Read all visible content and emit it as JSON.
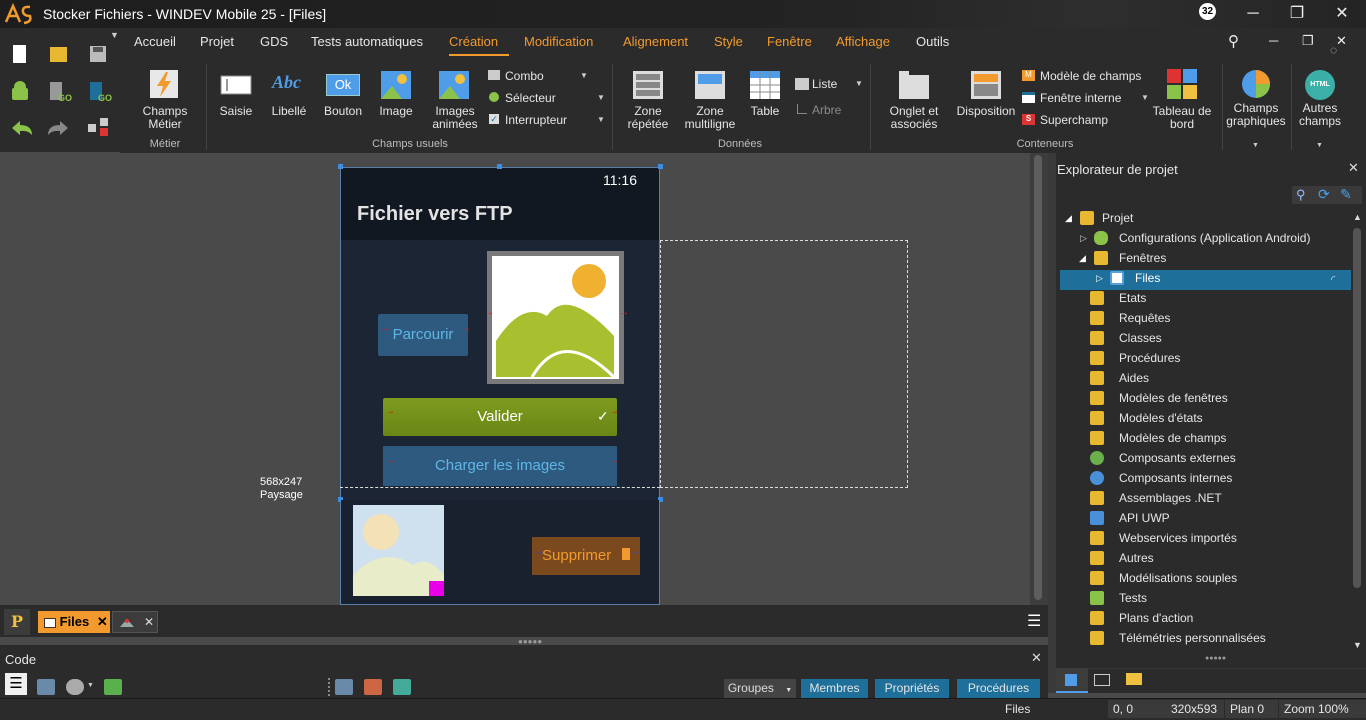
{
  "window": {
    "title": "Stocker Fichiers - WINDEV Mobile 25 - [Files]",
    "notification_count": "32",
    "controls": {
      "minimize": "─",
      "restore": "❐",
      "close": "✕"
    },
    "app_controls": {
      "search": "⚲",
      "minimize": "─",
      "restore": "❐",
      "close": "✕"
    }
  },
  "menu": {
    "items": [
      "Accueil",
      "Projet",
      "GDS",
      "Tests automatiques",
      "Création",
      "Modification",
      "Alignement",
      "Style",
      "Fenêtre",
      "Affichage",
      "Outils"
    ],
    "active": "Création",
    "orange_items": [
      "Création",
      "Modification",
      "Alignement",
      "Style",
      "Fenêtre",
      "Affichage"
    ]
  },
  "ribbon": {
    "groups": {
      "metier": "Métier",
      "champs_usuels": "Champs usuels",
      "donnees": "Données",
      "conteneurs": "Conteneurs"
    },
    "champs_metier": "Champs\nMétier",
    "saisie": "Saisie",
    "libelle": "Libellé",
    "bouton": "Bouton",
    "image": "Image",
    "images_animees": "Images\nanimées",
    "combo": "Combo",
    "selecteur": "Sélecteur",
    "interrupteur": "Interrupteur",
    "zone_repetee": "Zone\nrépétée",
    "zone_multiligne": "Zone\nmultiligne",
    "table": "Table",
    "liste": "Liste",
    "arbre": "Arbre",
    "onglet": "Onglet et\nassociés",
    "disposition": "Disposition",
    "modele_champs": "Modèle de champs",
    "fenetre_interne": "Fenêtre interne",
    "superchamp": "Superchamp",
    "tableau_bord": "Tableau de\nbord",
    "champs_graphiques": "Champs\ngraphiques",
    "autres_champs": "Autres\nchamps",
    "abc_icon": "Abc",
    "ok_icon": "Ok",
    "html_icon": "HTML"
  },
  "phone": {
    "time": "11:16",
    "title": "Fichier vers FTP",
    "btn_parcourir": "Parcourir",
    "btn_valider": "Valider",
    "btn_charger": "Charger les images",
    "btn_supprimer": "Supprimer",
    "size_label": "568x247",
    "orientation_label": "Paysage"
  },
  "doc_tabs": {
    "project_button": "P",
    "files_tab": "Files",
    "close": "✕"
  },
  "code_panel": {
    "title": "Code",
    "close": "✕",
    "groupes": "Groupes",
    "membres": "Membres",
    "proprietes": "Propriétés",
    "procedures": "Procédures"
  },
  "explorer": {
    "title": "Explorateur de projet",
    "close": "✕",
    "items": [
      {
        "label": "Projet",
        "color": "#e8b830"
      },
      {
        "label": "Configurations (Application Android)",
        "color": "#8bc34a"
      },
      {
        "label": "Fenêtres",
        "color": "#e8b830"
      },
      {
        "label": "Files",
        "color": "#5aa0d8"
      },
      {
        "label": "Etats",
        "color": "#e8b830"
      },
      {
        "label": "Requêtes",
        "color": "#e8b830"
      },
      {
        "label": "Classes",
        "color": "#e8b830"
      },
      {
        "label": "Procédures",
        "color": "#e8b830"
      },
      {
        "label": "Aides",
        "color": "#e8b830"
      },
      {
        "label": "Modèles de fenêtres",
        "color": "#e8b830"
      },
      {
        "label": "Modèles d'états",
        "color": "#e8b830"
      },
      {
        "label": "Modèles de champs",
        "color": "#e8b830"
      },
      {
        "label": "Composants externes",
        "color": "#6ab04c"
      },
      {
        "label": "Composants internes",
        "color": "#4a90d9"
      },
      {
        "label": "Assemblages .NET",
        "color": "#e8b830"
      },
      {
        "label": "API UWP",
        "color": "#4a90d9"
      },
      {
        "label": "Webservices importés",
        "color": "#e8b830"
      },
      {
        "label": "Autres",
        "color": "#e8b830"
      },
      {
        "label": "Modélisations souples",
        "color": "#e8b830"
      },
      {
        "label": "Tests",
        "color": "#8bc34a"
      },
      {
        "label": "Plans d'action",
        "color": "#e8b830"
      },
      {
        "label": "Télémétries personnalisées",
        "color": "#e8b830"
      }
    ],
    "selected": "Files"
  },
  "status": {
    "window_name": "Files",
    "coords": "0, 0",
    "dimensions": "320x593",
    "plan": "Plan 0",
    "zoom": "Zoom 100%"
  }
}
